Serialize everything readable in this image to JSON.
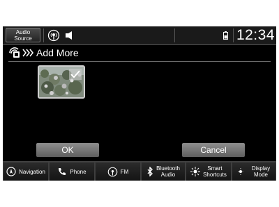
{
  "statusbar": {
    "audio_source_label": "Audio\nSource",
    "clock": "12:34",
    "icons": [
      "radio-icon",
      "speaker-icon",
      "phone-battery-icon"
    ]
  },
  "title": {
    "text": "Add More",
    "icons": [
      "phone-projection-icon",
      "triple-chevron-icon"
    ]
  },
  "thumbnail": {
    "selected": true,
    "check_icon": "checkmark-icon"
  },
  "dialog": {
    "ok_label": "OK",
    "cancel_label": "Cancel"
  },
  "navbar": {
    "items": [
      {
        "label": "Navigation",
        "icon": "compass-icon"
      },
      {
        "label": "Phone",
        "icon": "phone-icon"
      },
      {
        "label": "FM",
        "icon": "radio-icon"
      },
      {
        "label": "Bluetooth\nAudio",
        "icon": "bluetooth-icon"
      },
      {
        "label": "Smart\nShortcuts",
        "icon": "spark-icon"
      },
      {
        "label": "Display\nMode",
        "icon": "sun-moon-icon"
      }
    ]
  }
}
